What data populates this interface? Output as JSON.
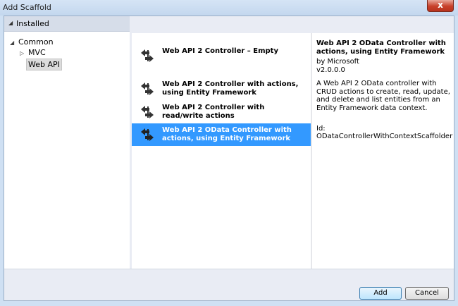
{
  "window": {
    "title": "Add Scaffold",
    "close_glyph": "x"
  },
  "tree": {
    "header_label": "Installed",
    "items": [
      {
        "label": "Common",
        "expanded": true
      },
      {
        "label": "MVC",
        "expanded": false
      },
      {
        "label": "Web API",
        "selected": true
      }
    ]
  },
  "scaffolds": [
    {
      "label": "Web API 2 Controller – Empty",
      "icon": "controller-icon",
      "selected": false
    },
    {
      "label": "Web API 2 Controller with actions, using Entity Framework",
      "icon": "controller-icon",
      "selected": false
    },
    {
      "label": "Web API 2 Controller with read/write actions",
      "icon": "controller-icon",
      "selected": false
    },
    {
      "label": "Web API 2 OData Controller with actions, using Entity Framework",
      "icon": "controller-icon",
      "selected": true
    }
  ],
  "details": {
    "title": "Web API 2 OData Controller with actions, using Entity Framework",
    "author": "by Microsoft",
    "version": "v2.0.0.0",
    "description": "A Web API 2 OData controller with CRUD actions to create, read, update, and delete and list entities from an Entity Framework data context.",
    "id": "Id: ODataControllerWithContextScaffolder"
  },
  "buttons": {
    "add": "Add",
    "cancel": "Cancel"
  },
  "colors": {
    "selection": "#3399ff",
    "frame": "#cfe0f3",
    "close": "#c7402a"
  }
}
